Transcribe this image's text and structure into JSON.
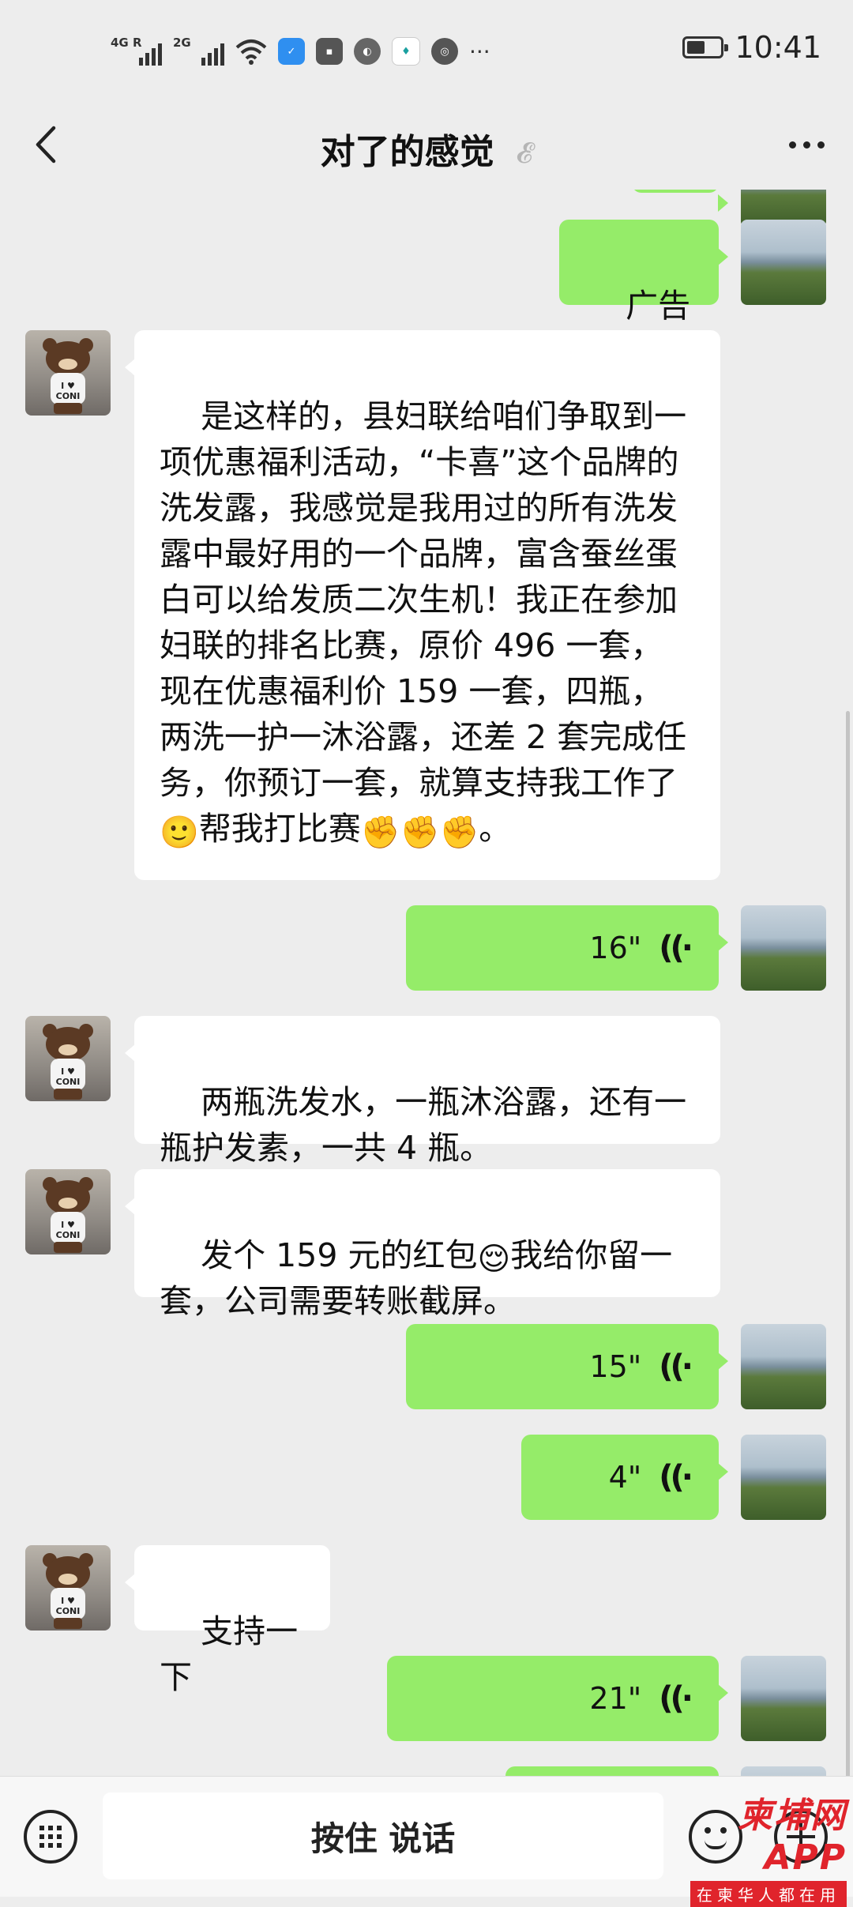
{
  "status_bar": {
    "signal_1": "4G R",
    "signal_2": "2G",
    "time": "10:41",
    "battery_level": 0.55,
    "more_indicator": "···"
  },
  "header": {
    "title": "对了的感觉",
    "icons": [
      "back-icon",
      "ear-muted-icon",
      "more-icon"
    ]
  },
  "messages": [
    {
      "side": "out",
      "type": "text",
      "text": "广告吗"
    },
    {
      "side": "in",
      "type": "text",
      "text": "是这样的，县妇联给咱们争取到一项优惠福利活动，“卡喜”这个品牌的洗发露，我感觉是我用过的所有洗发露中最好用的一个品牌，富含蚕丝蛋白可以给发质二次生机！我正在参加妇联的排名比赛，原价 496 一套，现在优惠福利价 159 一套，四瓶，两洗一护一沐浴露，还差 2 套完成任务，你预订一套，就算支持我工作了",
      "tail": "帮我打比赛",
      "end": "。"
    },
    {
      "side": "out",
      "type": "voice",
      "duration": "16\""
    },
    {
      "side": "in",
      "type": "text",
      "text": "两瓶洗发水，一瓶沐浴露，还有一瓶护发素，一共 4 瓶。"
    },
    {
      "side": "in",
      "type": "text",
      "text": "发个 159 元的红包",
      "tail": "我给你留一套，公司需要转账截屏。"
    },
    {
      "side": "out",
      "type": "voice",
      "duration": "15\""
    },
    {
      "side": "out",
      "type": "voice",
      "duration": "4\""
    },
    {
      "side": "in",
      "type": "text",
      "text": "支持一下"
    },
    {
      "side": "out",
      "type": "voice",
      "duration": "21\""
    }
  ],
  "emoji": {
    "smile": "🙂",
    "fist": "✊",
    "blush": "😌"
  },
  "avatar_labels": {
    "bear_shirt": "I ♥ CONI"
  },
  "input_bar": {
    "hold_to_talk": "按住 说话",
    "icons": [
      "keyboard-icon",
      "emoji-icon",
      "plus-icon"
    ]
  },
  "watermark": {
    "main": "柬埔网 APP",
    "sub": "在柬华人都在用"
  },
  "colors": {
    "background": "#ededed",
    "bubble_out": "#95ec69",
    "bubble_in": "#ffffff",
    "watermark": "#e0242c"
  }
}
